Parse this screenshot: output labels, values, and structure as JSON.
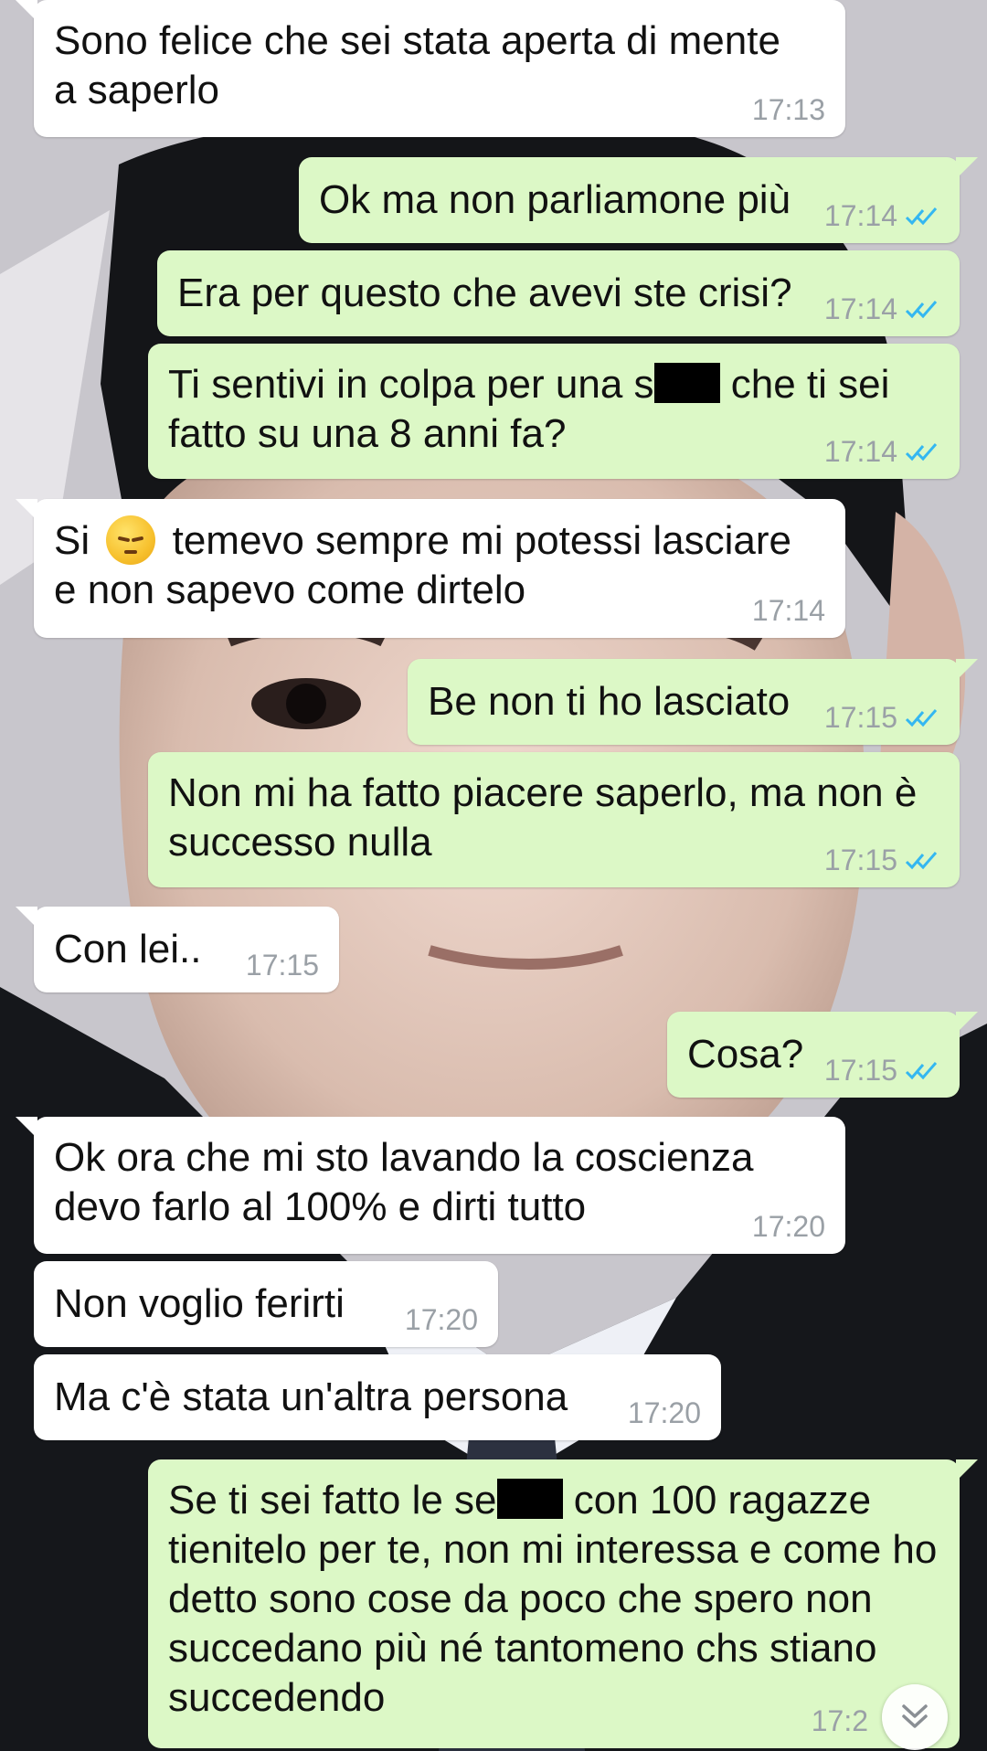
{
  "wallpaper": {
    "icon": "portrait-photo"
  },
  "messages": [
    {
      "direction": "in",
      "text": "Sono felice che sei stata aperta di mente a saperlo",
      "time": "17:13"
    },
    {
      "direction": "out",
      "text": "Ok ma non parliamone più",
      "time": "17:14",
      "status": "read"
    },
    {
      "direction": "out",
      "text": "Era per questo che avevi ste crisi?",
      "time": "17:14",
      "status": "read"
    },
    {
      "direction": "out",
      "text_a": "Ti sentivi in colpa per una s",
      "text_b": " che ti sei fatto su una 8 anni fa?",
      "time": "17:14",
      "status": "read"
    },
    {
      "direction": "in",
      "text_a": "Si",
      "emoji": "pensive-face-emoji",
      "text_b": "temevo sempre mi potessi lasciare e non sapevo come dirtelo",
      "time": "17:14"
    },
    {
      "direction": "out",
      "text": "Be non ti ho lasciato",
      "time": "17:15",
      "status": "read"
    },
    {
      "direction": "out",
      "text": "Non mi ha fatto piacere saperlo, ma non è successo nulla",
      "time": "17:15",
      "status": "read"
    },
    {
      "direction": "in",
      "text": "Con lei..",
      "time": "17:15"
    },
    {
      "direction": "out",
      "text": "Cosa?",
      "time": "17:15",
      "status": "read"
    },
    {
      "direction": "in",
      "text": "Ok ora che mi sto lavando la coscienza devo farlo al 100% e dirti tutto",
      "time": "17:20"
    },
    {
      "direction": "in",
      "text": "Non voglio ferirti",
      "time": "17:20"
    },
    {
      "direction": "in",
      "text": "Ma c'è stata un'altra persona",
      "time": "17:20"
    },
    {
      "direction": "out",
      "text_a": "Se ti sei fatto le se",
      "text_b": " con 100 ragazze tienitelo per te, non mi interessa e come ho detto sono cose da poco che spero non succedano più né tantomeno chs stiano succedendo",
      "time": "17:2"
    }
  ],
  "scroll_button": {
    "icon": "double-chevron-down-icon"
  },
  "colors": {
    "incoming_bubble": "#ffffff",
    "outgoing_bubble": "#dcf8c6",
    "read_ticks": "#34b7f1",
    "timestamp": "#9aa0a6"
  }
}
